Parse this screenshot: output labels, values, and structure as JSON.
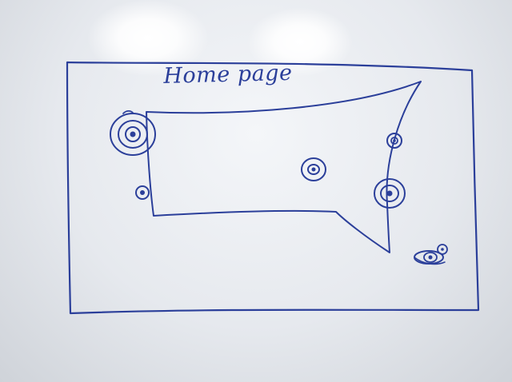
{
  "sketch": {
    "title": "Home page",
    "ink_color": "#2b3f9a",
    "board_color": "#e8ebf0"
  }
}
